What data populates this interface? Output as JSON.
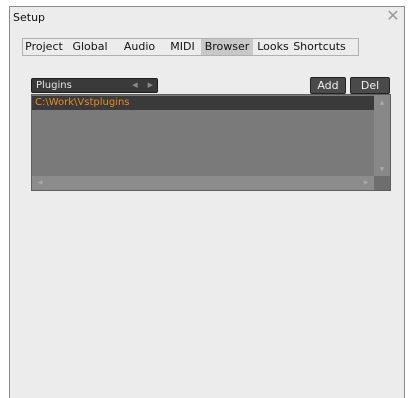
{
  "window": {
    "title": "Setup",
    "close_glyph": "✕"
  },
  "tabs": [
    {
      "label": "Project",
      "active": false
    },
    {
      "label": "Global",
      "active": false
    },
    {
      "label": "Audio",
      "active": false
    },
    {
      "label": "MIDI",
      "active": false
    },
    {
      "label": "Browser",
      "active": true
    },
    {
      "label": "Looks",
      "active": false
    },
    {
      "label": "Shortcuts",
      "active": false
    }
  ],
  "browser": {
    "location_select": {
      "value": "Plugins",
      "prev_icon": "chevron-left-icon",
      "next_icon": "chevron-right-icon"
    },
    "add_label": "Add",
    "del_label": "Del",
    "paths": [
      "C:\\Work\\Vstplugins"
    ]
  },
  "colors": {
    "window_bg": "#ececec",
    "control_bg": "#3a3a3a",
    "list_bg": "#7a7a7a",
    "selected_text": "#f08a1a"
  }
}
